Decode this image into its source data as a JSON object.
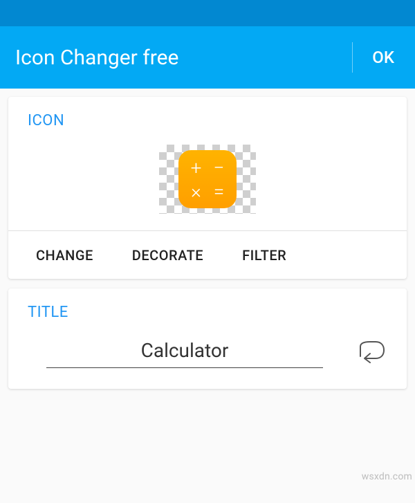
{
  "header": {
    "title": "Icon Changer free",
    "ok_label": "OK"
  },
  "icon_section": {
    "label": "ICON",
    "preview_icon": "calculator-app-icon",
    "tabs": {
      "change": "CHANGE",
      "decorate": "DECORATE",
      "filter": "FILTER"
    }
  },
  "title_section": {
    "label": "TITLE",
    "value": "Calculator",
    "undo_icon": "undo-icon"
  },
  "colors": {
    "primary": "#03a9f4",
    "primary_dark": "#0288d1",
    "accent_text": "#2196f3",
    "icon_bg": "#ffa000"
  },
  "watermark": "wsxdn.com"
}
